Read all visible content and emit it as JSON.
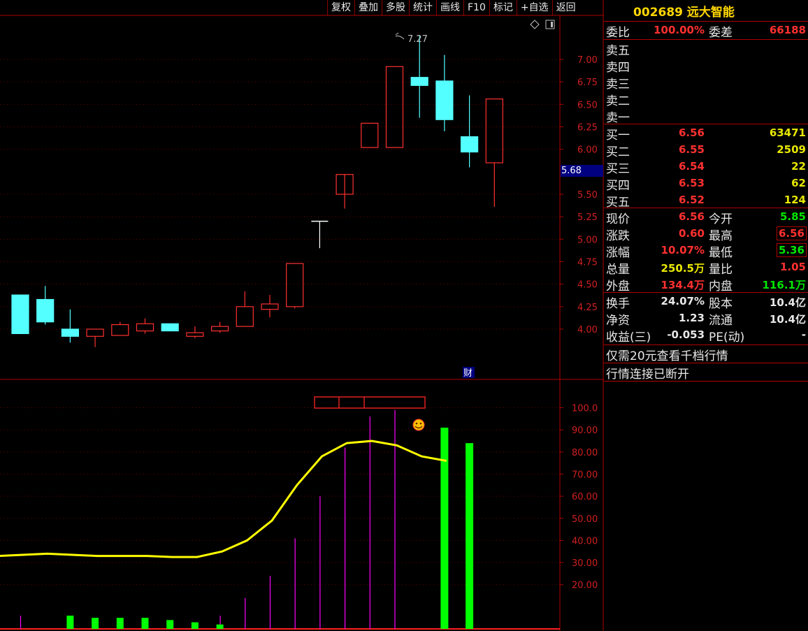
{
  "toolbar": {
    "items": [
      "复权",
      "叠加",
      "多股",
      "统计",
      "画线",
      "F10",
      "标记",
      "+自选",
      "返回"
    ]
  },
  "price_chart": {
    "y_ticks": [
      "7.00",
      "6.75",
      "6.50",
      "6.25",
      "6.00",
      "5.50",
      "5.25",
      "5.00",
      "4.75",
      "4.50",
      "4.25",
      "4.00"
    ],
    "tick_values": [
      7.0,
      6.75,
      6.5,
      6.25,
      6.0,
      5.5,
      5.25,
      5.0,
      4.75,
      4.5,
      4.25,
      4.0
    ],
    "current_price_tag": "5.68",
    "high_annotation": "7.27",
    "finance_badge": "财",
    "colors": {
      "up": "#ff3030",
      "down": "#54ffff",
      "flat": "#ffffff"
    },
    "candles": [
      {
        "o": 4.38,
        "h": 4.38,
        "l": 3.95,
        "c": 3.95
      },
      {
        "o": 4.33,
        "h": 4.48,
        "l": 4.05,
        "c": 4.08
      },
      {
        "o": 4.0,
        "h": 4.22,
        "l": 3.85,
        "c": 3.92
      },
      {
        "o": 3.92,
        "h": 4.0,
        "l": 3.8,
        "c": 4.0
      },
      {
        "o": 3.93,
        "h": 4.08,
        "l": 3.93,
        "c": 4.05
      },
      {
        "o": 3.98,
        "h": 4.12,
        "l": 3.95,
        "c": 4.06
      },
      {
        "o": 4.06,
        "h": 4.06,
        "l": 3.98,
        "c": 3.98
      },
      {
        "o": 3.92,
        "h": 4.03,
        "l": 3.9,
        "c": 3.96
      },
      {
        "o": 3.98,
        "h": 4.08,
        "l": 3.96,
        "c": 4.03
      },
      {
        "o": 4.03,
        "h": 4.42,
        "l": 4.03,
        "c": 4.25
      },
      {
        "o": 4.22,
        "h": 4.38,
        "l": 4.13,
        "c": 4.28
      },
      {
        "o": 4.25,
        "h": 4.73,
        "l": 4.23,
        "c": 4.73
      },
      {
        "o": 5.2,
        "h": 5.2,
        "l": 4.9,
        "c": 5.2
      },
      {
        "o": 5.5,
        "h": 5.5,
        "l": 5.34,
        "c": 5.72
      },
      {
        "o": 6.02,
        "h": 6.29,
        "l": 6.02,
        "c": 6.29
      },
      {
        "o": 6.02,
        "h": 6.92,
        "l": 6.02,
        "c": 6.92
      },
      {
        "o": 6.8,
        "h": 7.27,
        "l": 6.35,
        "c": 6.71
      },
      {
        "o": 6.76,
        "h": 7.05,
        "l": 6.2,
        "c": 6.33
      },
      {
        "o": 6.14,
        "h": 6.6,
        "l": 5.8,
        "c": 5.97
      },
      {
        "o": 5.85,
        "h": 6.56,
        "l": 5.36,
        "c": 6.56
      }
    ]
  },
  "indicator": {
    "y_ticks": [
      "100.0",
      "90.00",
      "80.00",
      "70.00",
      "60.00",
      "50.00",
      "40.00",
      "30.00",
      "20.00"
    ],
    "tick_values": [
      100,
      90,
      80,
      70,
      60,
      50,
      40,
      30,
      20
    ],
    "line_color": "#ffff00",
    "bar_color": "#00ff00",
    "spike_color": "#ff00ff",
    "line": [
      33,
      34,
      33.5,
      33,
      33,
      33,
      32.5,
      32.5,
      35,
      40,
      49,
      65,
      78,
      84,
      85,
      83,
      78,
      76
    ],
    "spikes": [
      6,
      0,
      0,
      0,
      0,
      0,
      0,
      0,
      6,
      14,
      24,
      41,
      60,
      82,
      96,
      99,
      0,
      0
    ],
    "bars": [
      0,
      6,
      5,
      5,
      5,
      4,
      3,
      2,
      0,
      0,
      0,
      0,
      0,
      0,
      0,
      0,
      91,
      84
    ]
  },
  "quote": {
    "code": "002689",
    "name": "远大智能",
    "weibi_label": "委比",
    "weibi_value": "100.00%",
    "weicha_label": "委差",
    "weicha_value": "66188",
    "sells": [
      "卖五",
      "卖四",
      "卖三",
      "卖二",
      "卖一"
    ],
    "buys": [
      {
        "label": "买一",
        "price": "6.56",
        "vol": "63471"
      },
      {
        "label": "买二",
        "price": "6.55",
        "vol": "2509"
      },
      {
        "label": "买三",
        "price": "6.54",
        "vol": "22"
      },
      {
        "label": "买四",
        "price": "6.53",
        "vol": "62"
      },
      {
        "label": "买五",
        "price": "6.52",
        "vol": "124"
      }
    ],
    "stats": [
      {
        "l1": "现价",
        "v1": "6.56",
        "c1": "red",
        "l2": "今开",
        "v2": "5.85",
        "c2": "green",
        "b2": false
      },
      {
        "l1": "涨跌",
        "v1": "0.60",
        "c1": "red",
        "l2": "最高",
        "v2": "6.56",
        "c2": "red",
        "b2": true
      },
      {
        "l1": "涨幅",
        "v1": "10.07%",
        "c1": "red",
        "l2": "最低",
        "v2": "5.36",
        "c2": "green",
        "b2": true
      },
      {
        "l1": "总量",
        "v1": "250.5万",
        "c1": "yellow",
        "l2": "量比",
        "v2": "1.05",
        "c2": "red",
        "b2": false
      },
      {
        "l1": "外盘",
        "v1": "134.4万",
        "c1": "red",
        "l2": "内盘",
        "v2": "116.1万",
        "c2": "green",
        "b2": false
      }
    ],
    "finance": [
      {
        "l1": "换手",
        "v1": "24.07%",
        "l2": "股本",
        "v2": "10.4亿"
      },
      {
        "l1": "净资",
        "v1": "1.23",
        "l2": "流通",
        "v2": "10.4亿"
      },
      {
        "l1": "收益(三)",
        "v1": "-0.053",
        "l2": "PE(动)",
        "v2": "-"
      }
    ],
    "promo": "仅需20元查看千档行情",
    "status": "行情连接已断开"
  }
}
